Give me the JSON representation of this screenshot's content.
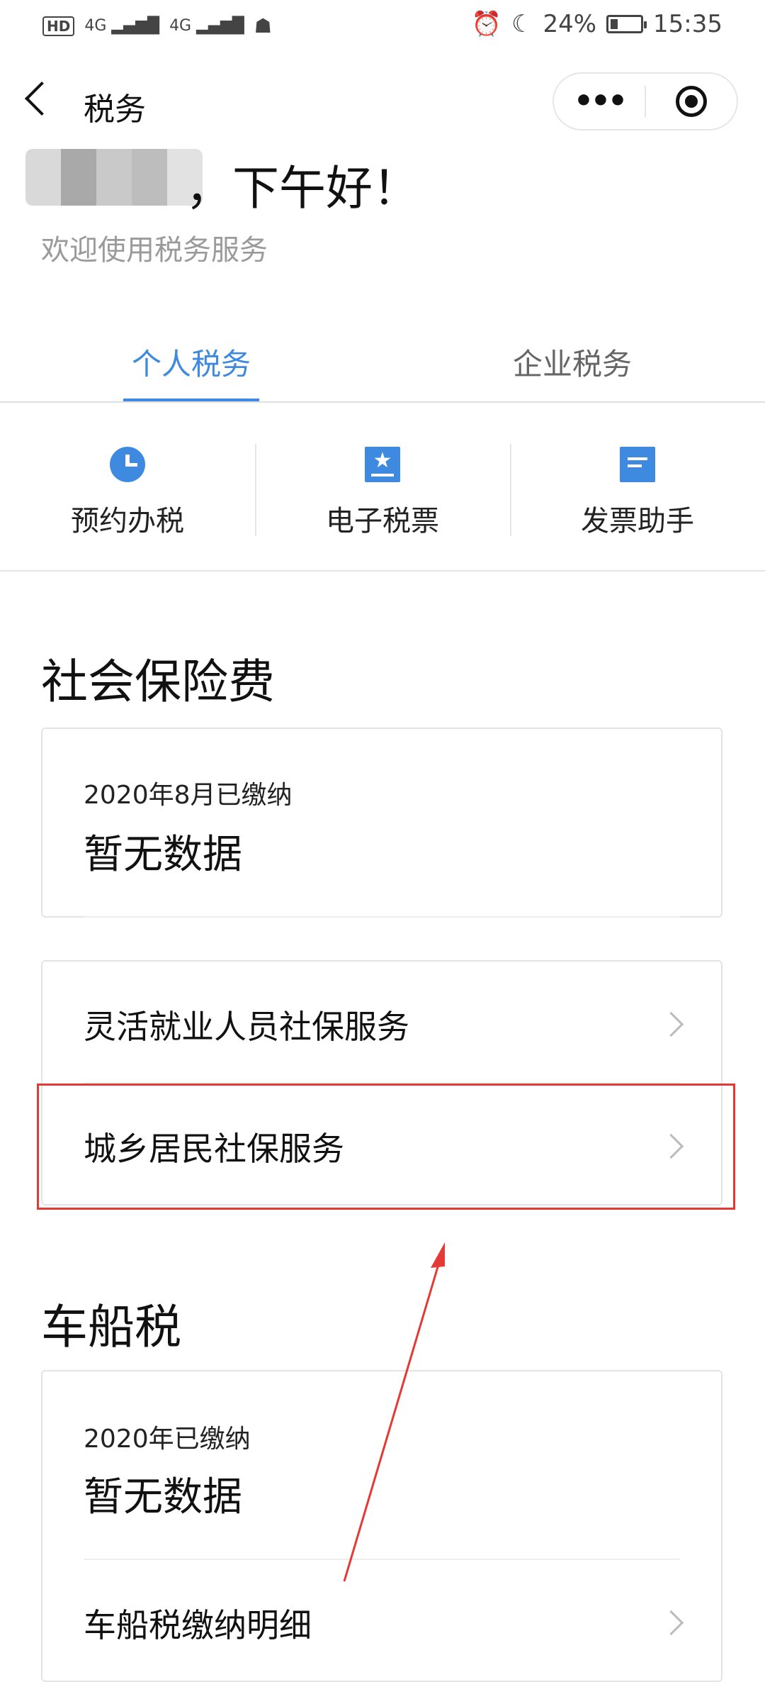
{
  "status_bar": {
    "hd": "HD",
    "sim1_net": "4G",
    "sim2_net": "4G",
    "battery_percent": "24%",
    "battery_level": 0.24,
    "time": "15:35"
  },
  "nav": {
    "title": "税务"
  },
  "greeting": {
    "text": "，下午好！",
    "subtitle": "欢迎使用税务服务"
  },
  "tabs": [
    {
      "label": "个人税务",
      "active": true
    },
    {
      "label": "企业税务",
      "active": false
    }
  ],
  "quick_actions": [
    {
      "label": "预约办税",
      "icon": "clock-icon"
    },
    {
      "label": "电子税票",
      "icon": "star-ticket-icon"
    },
    {
      "label": "发票助手",
      "icon": "document-icon"
    }
  ],
  "social_insurance": {
    "title": "社会保险费",
    "paid_label": "2020年8月已缴纳",
    "paid_value": "暂无数据",
    "services": [
      {
        "label": "灵活就业人员社保服务"
      },
      {
        "label": "城乡居民社保服务"
      }
    ]
  },
  "vehicle_tax": {
    "title": "车船税",
    "paid_label": "2020年已缴纳",
    "paid_value": "暂无数据",
    "detail_label": "车船税缴纳明细"
  },
  "colors": {
    "accent": "#3d8ae0",
    "annotation": "#e53935"
  }
}
